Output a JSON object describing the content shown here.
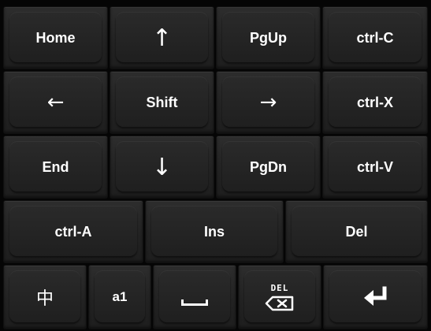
{
  "keyboard": {
    "rows": [
      {
        "keys": [
          "Home",
          "↑",
          "PgUp",
          "ctrl-C"
        ]
      },
      {
        "keys": [
          "←",
          "Shift",
          "→",
          "ctrl-X"
        ]
      },
      {
        "keys": [
          "End",
          "↓",
          "PgDn",
          "ctrl-V"
        ]
      },
      {
        "keys": [
          "ctrl-A",
          "Ins",
          "Del"
        ]
      },
      {
        "keys": [
          "中",
          "a1",
          "",
          "DEL",
          ""
        ]
      }
    ],
    "icons": {
      "space": "space-bar-icon",
      "backspace": "backspace-icon",
      "enter": "enter-return-icon"
    },
    "colors": {
      "key_face": "#262626",
      "background": "#050505",
      "label": "#ffffff"
    }
  }
}
